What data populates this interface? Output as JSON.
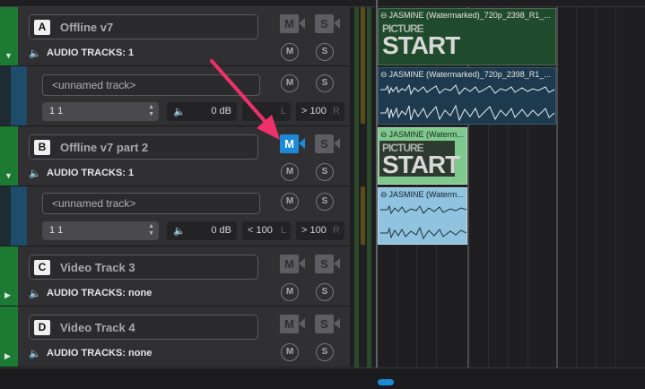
{
  "controls": {
    "mute": "M",
    "solo": "S"
  },
  "video_tracks": [
    {
      "letter": "A",
      "name": "Offline v7",
      "audio_tracks": "AUDIO TRACKS: 1"
    },
    {
      "letter": "B",
      "name": "Offline v7 part 2",
      "audio_tracks": "AUDIO TRACKS: 1"
    },
    {
      "letter": "C",
      "name": "Video Track 3",
      "audio_tracks": "AUDIO TRACKS: none"
    },
    {
      "letter": "D",
      "name": "Video Track 4",
      "audio_tracks": "AUDIO TRACKS: none"
    }
  ],
  "audio_tracks": [
    {
      "name": "<unnamed track>",
      "channel": "1 1",
      "volume": "0 dB",
      "pan_left": "L",
      "pan_right": "> 100",
      "pan_right_label": "R"
    },
    {
      "name": "<unnamed track>",
      "channel": "1 1",
      "volume": "0 dB",
      "pan_left": "< 100",
      "pan_left_label": "L",
      "pan_right": "> 100",
      "pan_right_label": "R"
    }
  ],
  "clips": {
    "a_video": "JASMINE (Watermarked)_720p_2398_R1_...",
    "a_audio": "JASMINE (Watermarked)_720p_2398_R1_...",
    "b_video": "JASMINE (Waterm...",
    "b_audio": "JASMINE (Waterm...",
    "slate_top": "PICTURE",
    "slate_bottom": "START"
  },
  "colors": {
    "accent": "#1d8ad8",
    "video_clip": "#1f4a2c",
    "video_clip_selected": "#7fc98e",
    "audio_clip": "#1e3a4e",
    "audio_clip_selected": "#8fc3e0",
    "arrow": "#f0306a"
  }
}
